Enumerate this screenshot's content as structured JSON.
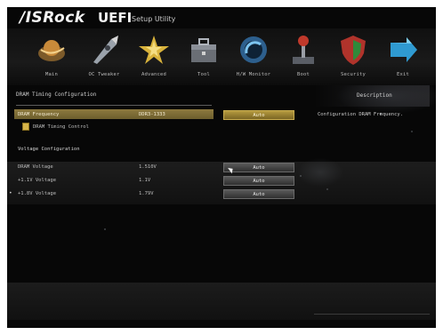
{
  "header": {
    "brand": "/ISRock",
    "product": "UEFI",
    "subtitle": "Setup Utility"
  },
  "menu": [
    {
      "label": "Main",
      "icon": "planet-icon"
    },
    {
      "label": "OC Tweaker",
      "icon": "rocket-icon"
    },
    {
      "label": "Advanced",
      "icon": "star-icon"
    },
    {
      "label": "Tool",
      "icon": "toolbox-icon"
    },
    {
      "label": "H/W Monitor",
      "icon": "monitor-icon"
    },
    {
      "label": "Boot",
      "icon": "joystick-icon"
    },
    {
      "label": "Security",
      "icon": "shield-icon"
    },
    {
      "label": "Exit",
      "icon": "exit-arrow-icon"
    }
  ],
  "section": {
    "title": "DRAM Timing Configuration"
  },
  "description": {
    "title": "Description",
    "text": "Configuration DRAM Frequency."
  },
  "rows": {
    "dram_frequency": {
      "label": "DRAM Frequency",
      "value": "DDR3-1333",
      "button": "Auto"
    },
    "dram_timing_control": {
      "label": "DRAM Timing Control"
    },
    "voltage_header": {
      "label": "Voltage Configuration"
    },
    "dram_voltage": {
      "label": "DRAM Voltage",
      "value": "1.510V",
      "button": "Auto"
    },
    "v_1_1": {
      "label": "+1.1V Voltage",
      "value": "1.1V",
      "button": "Auto"
    },
    "v_1_8": {
      "label": "+1.8V Voltage",
      "value": "1.79V",
      "button": "Auto"
    }
  }
}
